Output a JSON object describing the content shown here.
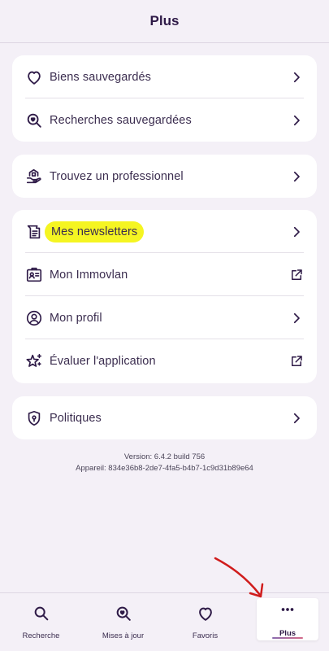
{
  "header": {
    "title": "Plus"
  },
  "groups": [
    {
      "items": [
        {
          "label": "Biens sauvegardés",
          "icon": "heart-icon",
          "trailing": "chevron"
        },
        {
          "label": "Recherches sauvegardées",
          "icon": "search-heart-icon",
          "trailing": "chevron"
        }
      ]
    },
    {
      "items": [
        {
          "label": "Trouvez un professionnel",
          "icon": "house-hand-icon",
          "trailing": "chevron"
        }
      ]
    },
    {
      "items": [
        {
          "label": "Mes newsletters",
          "icon": "newsletter-icon",
          "trailing": "chevron",
          "highlighted": true
        },
        {
          "label": "Mon Immovlan",
          "icon": "id-card-icon",
          "trailing": "external"
        },
        {
          "label": "Mon profil",
          "icon": "user-circle-icon",
          "trailing": "chevron"
        },
        {
          "label": "Évaluer l'application",
          "icon": "star-sparkle-icon",
          "trailing": "external"
        }
      ]
    },
    {
      "items": [
        {
          "label": "Politiques",
          "icon": "shield-icon",
          "trailing": "chevron"
        }
      ]
    }
  ],
  "footer": {
    "version": "Version: 6.4.2 build 756",
    "device": "Appareil: 834e36b8-2de7-4fa5-b4b7-1c9d31b89e64"
  },
  "tabbar": {
    "tabs": [
      {
        "label": "Recherche",
        "icon": "search-icon"
      },
      {
        "label": "Mises à jour",
        "icon": "search-heart-icon"
      },
      {
        "label": "Favoris",
        "icon": "heart-icon"
      },
      {
        "label": "Plus",
        "icon": "more-dots-icon",
        "active": true
      }
    ]
  },
  "colors": {
    "accent": "#2e1a47",
    "background": "#f4f0f7",
    "highlight": "#f5f522",
    "annotation": "#d01c1c"
  }
}
